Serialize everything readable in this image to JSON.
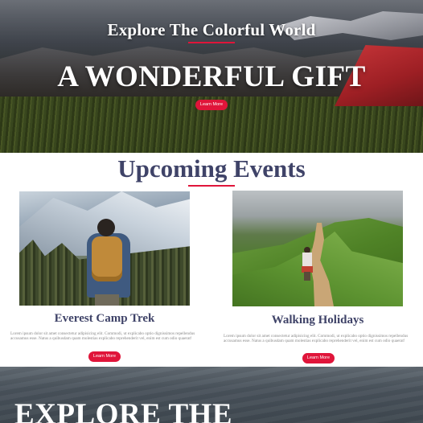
{
  "hero": {
    "title": "Explore The Colorful World",
    "headline": "A WONDERFUL GIFT",
    "button_label": "Learn More"
  },
  "events": {
    "title": "Upcoming Events",
    "cards": [
      {
        "title": "Everest Camp Trek",
        "text": "Lorem ipsum dolor sit amet consectetur adipisicing elit. Commodi, ut explicabo optio dignissimos repellendus accusamus esse. Natus a quibusdam quam molestias explicabo reprehenderit vel, enim est cum odio quaerat!",
        "button_label": "Learn More"
      },
      {
        "title": "Walking Holidays",
        "text": "Lorem ipsum dolor sit amet consectetur adipisicing elit. Commodi, ut explicabo optio dignissimos repellendus accusamus esse. Natus a quibusdam quam molestias explicabo reprehenderit vel, enim est cum odio quaerat!",
        "button_label": "Learn More"
      }
    ]
  },
  "bottom": {
    "headline": "EXPLORE THE"
  },
  "colors": {
    "accent": "#e0153a",
    "heading": "#3f4368"
  }
}
